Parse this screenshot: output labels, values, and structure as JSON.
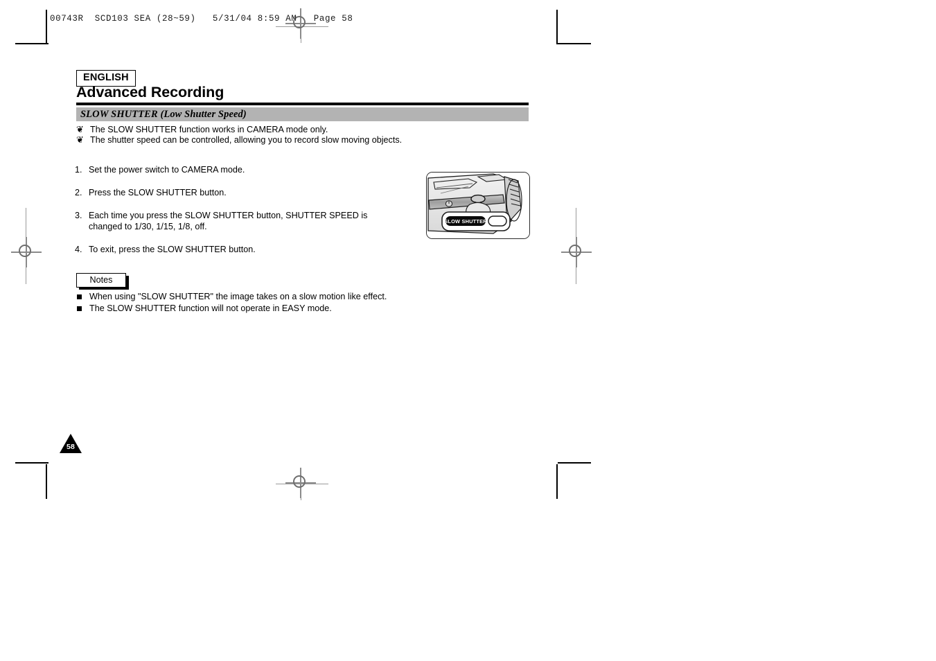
{
  "slug": {
    "text": "00743R  SCD103 SEA (28~59)   5/31/04 8:59 AM   Page 58"
  },
  "page": {
    "language_badge": "ENGLISH",
    "chapter_title": "Advanced Recording",
    "section_heading": "SLOW SHUTTER (Low Shutter Speed)",
    "page_number": "58"
  },
  "intro_bullets": [
    {
      "marker": "❦",
      "text": "The SLOW SHUTTER function works in CAMERA mode only."
    },
    {
      "marker": "❦",
      "text": "The shutter speed can be controlled, allowing you to record slow moving objects."
    }
  ],
  "steps": [
    {
      "num": "1.",
      "text": "Set the power switch to CAMERA mode."
    },
    {
      "num": "2.",
      "text": "Press the SLOW SHUTTER button."
    },
    {
      "num": "3.",
      "text": "Each time you press the SLOW SHUTTER button, SHUTTER SPEED is changed to 1/30, 1/15, 1/8, off."
    },
    {
      "num": "4.",
      "text": "To exit, press the SLOW SHUTTER button."
    }
  ],
  "notes": {
    "label": "Notes",
    "items": [
      "When using \"SLOW SHUTTER\" the image takes on a slow motion like effect.",
      "The SLOW SHUTTER function will not operate in EASY mode."
    ]
  },
  "figure": {
    "caption_pill": "SLOW SHUTTER",
    "alt": "camcorder body with SLOW SHUTTER button callout"
  },
  "colors": {
    "section_bar": "#b3b3b3",
    "rule": "#000000",
    "registration": "#8a8a8a"
  }
}
